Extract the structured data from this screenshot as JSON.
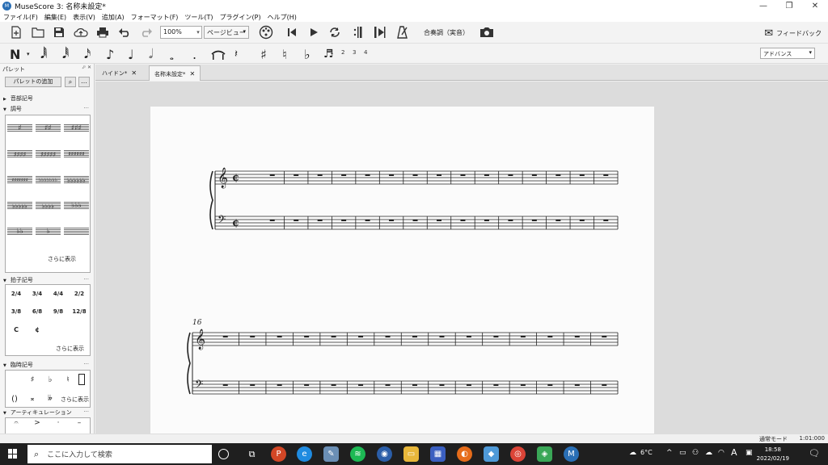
{
  "window": {
    "title": "MuseScore 3: 名称未設定*",
    "controls": [
      "—",
      "❐",
      "✕"
    ]
  },
  "menu": [
    "ファイル(F)",
    "編集(E)",
    "表示(V)",
    "追加(A)",
    "フォーマット(F)",
    "ツール(T)",
    "プラグイン(P)",
    "ヘルプ(H)"
  ],
  "toolbar": {
    "zoom_value": "100%",
    "view_mode": "ページビュー",
    "concert_pitch": "合奏調（実音）",
    "feedback": "フィードバック"
  },
  "note_input": {
    "voices": [
      "1",
      "2",
      "3",
      "4"
    ],
    "workspace": "アドバンス"
  },
  "palette": {
    "title": "パレット",
    "add_button": "パレットの追加",
    "sections": {
      "clefs": "音部記号",
      "keysig": "調号",
      "timesig": "拍子記号",
      "accidentals": "臨時記号",
      "articulations": "アーティキュレーション"
    },
    "show_more": "さらに表示",
    "timesig_cells": [
      "2/4",
      "3/4",
      "4/4",
      "2/2",
      "3/8",
      "6/8",
      "9/8",
      "12/8",
      "C",
      "¢"
    ],
    "accidental_cells": [
      "♯",
      "♭",
      "♮",
      "()",
      "𝄪",
      "𝄫"
    ]
  },
  "tabs": [
    {
      "label": "ハイドン*",
      "close": "✕"
    },
    {
      "label": "名称未設定*",
      "close": "✕"
    }
  ],
  "score": {
    "second_system_measure": "16",
    "measures_system1": 15,
    "measures_system2": 15
  },
  "status": {
    "mode": "通常モード",
    "position": "1:01:000"
  },
  "taskbar": {
    "search_placeholder": "ここに入力して検索",
    "temperature": "6°C",
    "ime": "A",
    "time": "18:58",
    "date": "2022/02/19",
    "notif_count": "1"
  }
}
